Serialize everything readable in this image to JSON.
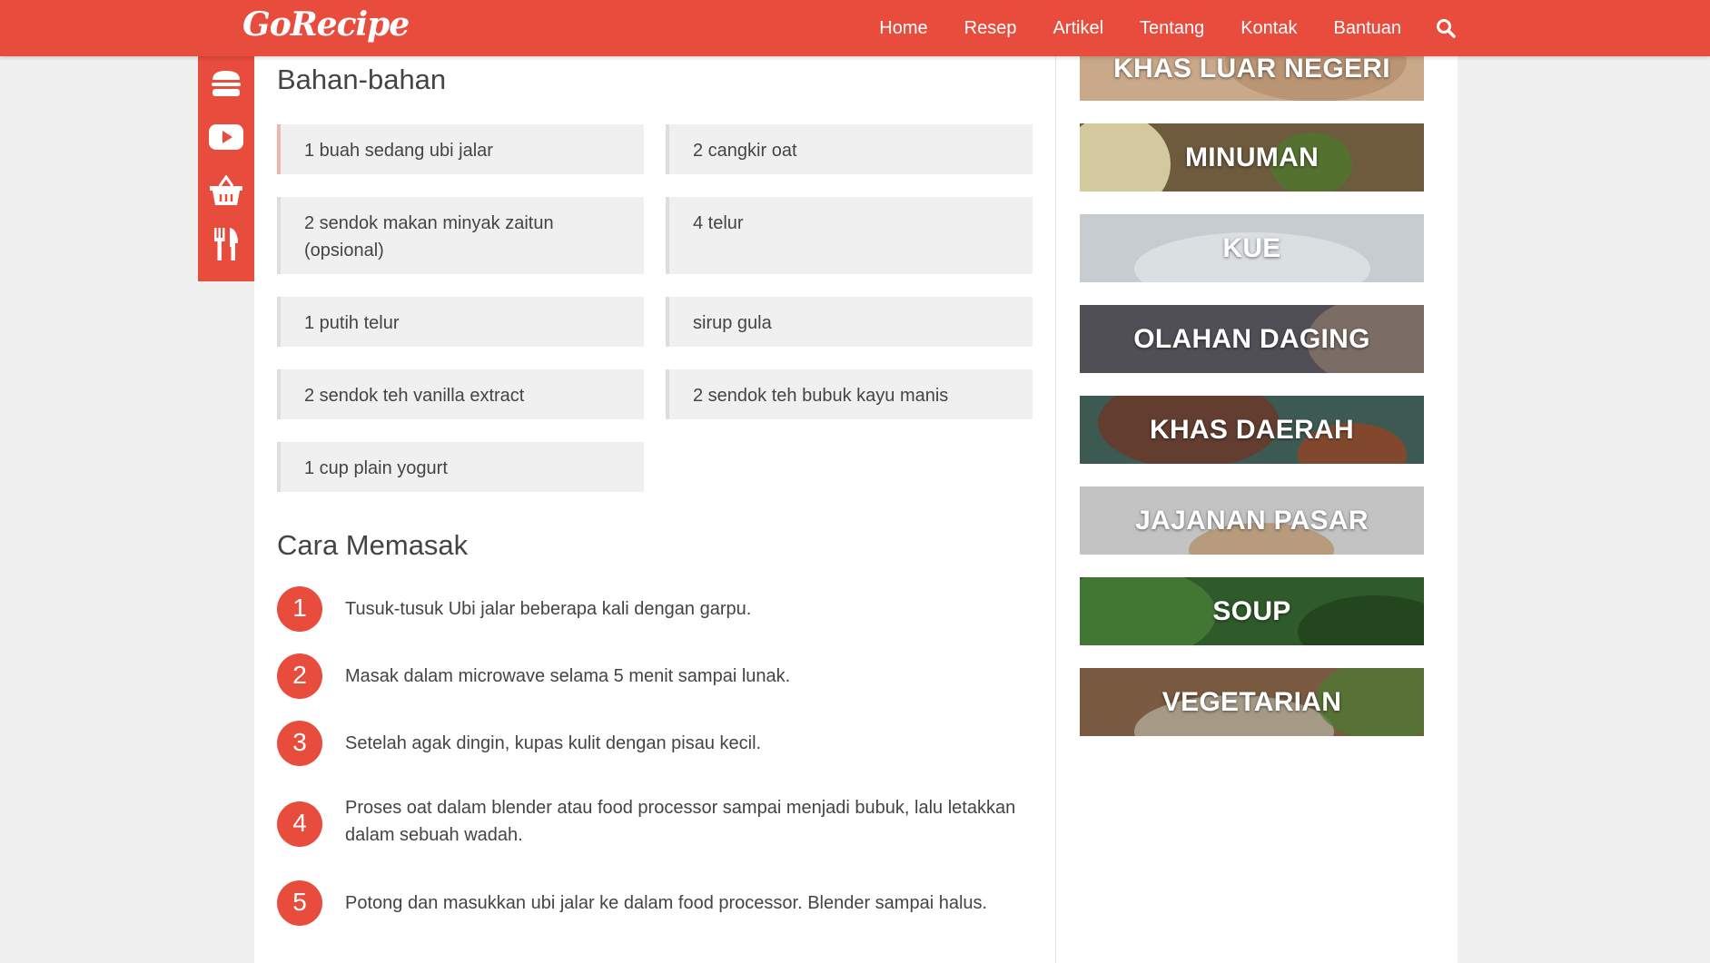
{
  "brand": {
    "logo": "GoRecipe",
    "accent": "#e84c3d"
  },
  "nav": {
    "items": [
      "Home",
      "Resep",
      "Artikel",
      "Tentang",
      "Kontak",
      "Bantuan"
    ]
  },
  "side_icons": [
    "burger-icon",
    "youtube-icon",
    "basket-icon",
    "utensils-icon"
  ],
  "ingredients": {
    "title": "Bahan-bahan",
    "items": [
      "1 buah sedang ubi jalar",
      "2 cangkir oat",
      "2 sendok makan minyak zaitun (opsional)",
      "4 telur",
      "1 putih telur",
      "sirup gula",
      "2 sendok teh vanilla extract",
      "2 sendok teh bubuk kayu manis",
      "1 cup plain yogurt"
    ]
  },
  "steps": {
    "title": "Cara Memasak",
    "items": [
      {
        "num": "1",
        "text": "Tusuk-tusuk Ubi jalar beberapa kali dengan garpu."
      },
      {
        "num": "2",
        "text": "Masak dalam microwave selama 5 menit sampai lunak."
      },
      {
        "num": "3",
        "text": "Setelah agak dingin, kupas kulit dengan pisau kecil."
      },
      {
        "num": "4",
        "text": "Proses oat dalam blender atau food processor sampai menjadi bubuk, lalu letakkan dalam sebuah wadah."
      },
      {
        "num": "5",
        "text": "Potong dan masukkan ubi jalar ke dalam food processor. Blender sampai halus."
      }
    ]
  },
  "categories": [
    {
      "label": "KHAS LUAR NEGERI",
      "bg": "#c9a98a"
    },
    {
      "label": "MINUMAN",
      "bg": "#6e5a3c"
    },
    {
      "label": "KUE",
      "bg": "#c6ccd0"
    },
    {
      "label": "OLAHAN DAGING",
      "bg": "#4f4f55"
    },
    {
      "label": "KHAS DAERAH",
      "bg": "#3d5a52"
    },
    {
      "label": "JAJANAN PASAR",
      "bg": "#c3c3c3"
    },
    {
      "label": "SOUP",
      "bg": "#2f5a2a"
    },
    {
      "label": "VEGETARIAN",
      "bg": "#7a5a40"
    }
  ]
}
